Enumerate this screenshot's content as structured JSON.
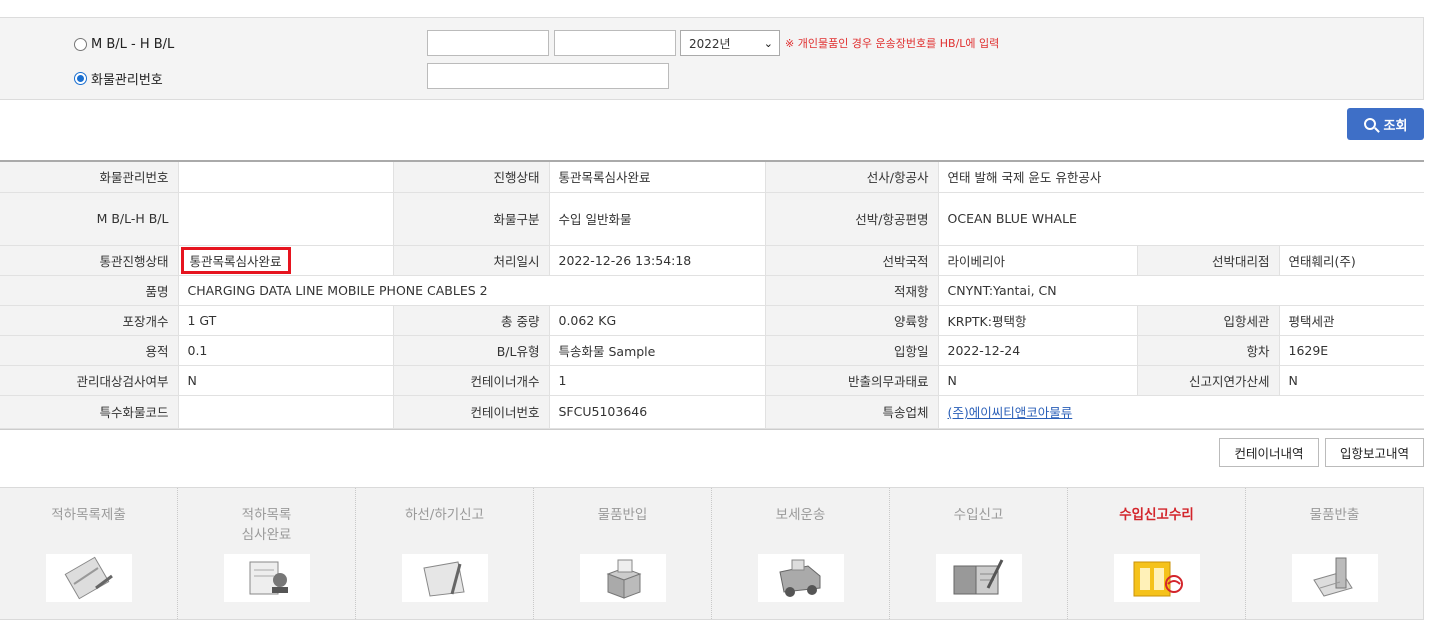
{
  "search": {
    "option_mbl": "M B/L - H B/L",
    "option_cargo": "화물관리번호",
    "year": "2022년",
    "note": "※ 개인물품인 경우 운송장번호를 HB/L에 입력",
    "button": "조회"
  },
  "info": {
    "r1": {
      "k1": "화물관리번호",
      "v1": "",
      "k2": "진행상태",
      "v2": "통관목록심사완료",
      "k3": "선사/항공사",
      "v3": "연태 발해 국제 윤도 유한공사"
    },
    "r2": {
      "k1": "M B/L-H B/L",
      "v1": "",
      "k2": "화물구분",
      "v2": "수입 일반화물",
      "k3": "선박/항공편명",
      "v3": "OCEAN BLUE WHALE"
    },
    "r3": {
      "k1": "통관진행상태",
      "v1": "통관목록심사완료",
      "k2": "처리일시",
      "v2": "2022-12-26 13:54:18",
      "k3": "선박국적",
      "v3": "라이베리아",
      "k4": "선박대리점",
      "v4": "연태훼리(주)"
    },
    "r4": {
      "k1": "품명",
      "v1": "CHARGING DATA LINE MOBILE PHONE CABLES 2",
      "k3": "적재항",
      "v3": "CNYNT:Yantai, CN"
    },
    "r5": {
      "k1": "포장개수",
      "v1": "1 GT",
      "k2": "총 중량",
      "v2": "0.062 KG",
      "k3": "양륙항",
      "v3": "KRPTK:평택항",
      "k4": "입항세관",
      "v4": "평택세관"
    },
    "r6": {
      "k1": "용적",
      "v1": "0.1",
      "k2": "B/L유형",
      "v2": "특송화물 Sample",
      "k3": "입항일",
      "v3": "2022-12-24",
      "k4": "항차",
      "v4": "1629E"
    },
    "r7": {
      "k1": "관리대상검사여부",
      "v1": "N",
      "k2": "컨테이너개수",
      "v2": "1",
      "k3": "반출의무과태료",
      "v3": "N",
      "k4": "신고지연가산세",
      "v4": "N"
    },
    "r8": {
      "k1": "특수화물코드",
      "v1": "",
      "k2": "컨테이너번호",
      "v2": "SFCU5103646",
      "k3": "특송업체",
      "v3": "(주)에이씨티앤코아물류"
    }
  },
  "buttons": {
    "container": "컨테이너내역",
    "arrival": "입항보고내역"
  },
  "steps": [
    {
      "label": "적하목록제출",
      "icon": "clipboard-pen-icon",
      "active": false
    },
    {
      "label": "적하목록\n심사완료",
      "icon": "document-stamp-icon",
      "active": false
    },
    {
      "label": "하선/하기신고",
      "icon": "folder-pen-icon",
      "active": false
    },
    {
      "label": "물품반입",
      "icon": "open-box-icon",
      "active": false
    },
    {
      "label": "보세운송",
      "icon": "truck-icon",
      "active": false
    },
    {
      "label": "수입신고",
      "icon": "notebook-pen-icon",
      "active": false
    },
    {
      "label": "수입신고수리",
      "icon": "approved-document-icon",
      "active": true
    },
    {
      "label": "물품반출",
      "icon": "release-document-icon",
      "active": false
    }
  ],
  "colors": {
    "accent": "#3e6fc7",
    "highlight": "#e6141f",
    "active_step": "#d3252b"
  }
}
